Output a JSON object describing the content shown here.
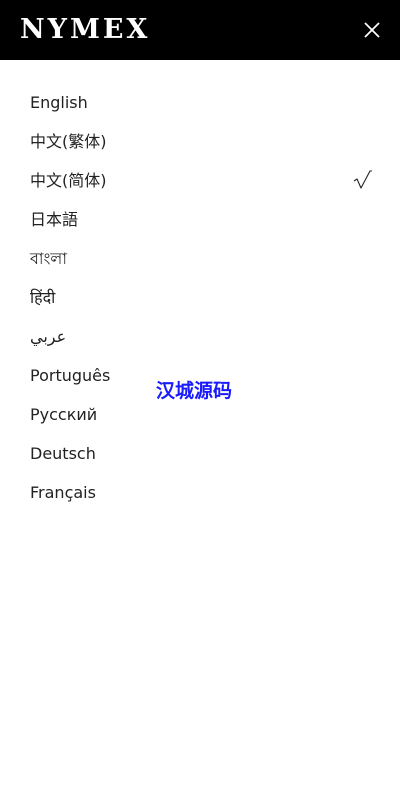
{
  "header": {
    "logo_text": "NYMEX",
    "close_icon": "close-icon",
    "background_color": "#000000",
    "text_color": "#ffffff"
  },
  "languages": [
    {
      "label": "English",
      "selected": false
    },
    {
      "label": "中文(繁体)",
      "selected": false
    },
    {
      "label": "中文(简体)",
      "selected": true
    },
    {
      "label": "日本語",
      "selected": false
    },
    {
      "label": "বাংলা",
      "selected": false
    },
    {
      "label": "हिंदी",
      "selected": false
    },
    {
      "label": "عربي",
      "selected": false
    },
    {
      "label": "Português",
      "selected": false
    },
    {
      "label": "Русский",
      "selected": false
    },
    {
      "label": "Deutsch",
      "selected": false
    },
    {
      "label": "Français",
      "selected": false
    }
  ],
  "selected_marker": "√",
  "watermark": {
    "text": "汉城源码",
    "color": "#1a1aff"
  }
}
